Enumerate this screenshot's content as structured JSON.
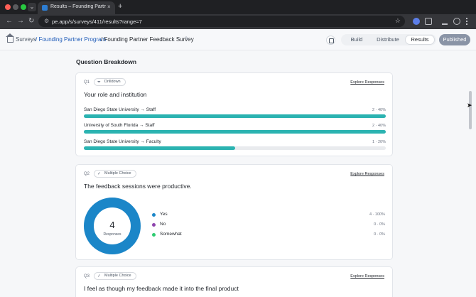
{
  "browser": {
    "tab_title": "Results – Founding Partner F",
    "tab_close": "×",
    "new_tab": "+",
    "url": "pe.app/s/surveys/411/results?range=7",
    "nav": {
      "back": "←",
      "forward": "→",
      "reload": "↻"
    },
    "star": "☆"
  },
  "header": {
    "breadcrumb": [
      {
        "label": "Surveys"
      },
      {
        "label": "/ Founding Partner Program"
      },
      {
        "label": "/ Founding Partner Feedback Survey"
      }
    ],
    "edit_icon": "✎",
    "tabs": [
      "Build",
      "Distribute",
      "Results"
    ],
    "active_tab": "Results",
    "status": "Published"
  },
  "main": {
    "section_title": "Question Breakdown",
    "questions": [
      {
        "number": "Q1",
        "type": "Drilldown",
        "type_icon": "funnel-icon",
        "explore": "Explore Responses",
        "title": "Your role and institution",
        "rows": [
          {
            "label": "San Diego State University → Staff",
            "value": "2 · 40%",
            "fraction": 1.0
          },
          {
            "label": "University of South Florida → Staff",
            "value": "2 · 40%",
            "fraction": 1.0
          },
          {
            "label": "San Diego State University → Faculty",
            "value": "1 · 20%",
            "fraction": 0.5
          }
        ]
      },
      {
        "number": "Q2",
        "type": "Multiple Choice",
        "type_icon": "check-circle-icon",
        "explore": "Explore Responses",
        "title": "The feedback sessions were productive.",
        "total": "4",
        "total_label": "Responses",
        "options": [
          {
            "label": "Yes",
            "value": "4 · 100%",
            "color": "#1b86c8",
            "fraction": 1.0
          },
          {
            "label": "No",
            "value": "0 · 0%",
            "color": "#8e44ad",
            "fraction": 0.0
          },
          {
            "label": "Somewhat",
            "value": "0 · 0%",
            "color": "#2ecc71",
            "fraction": 0.0
          }
        ]
      },
      {
        "number": "Q3",
        "type": "Multiple Choice",
        "type_icon": "check-circle-icon",
        "explore": "Explore Responses",
        "title": "I feel as though my feedback made it into the final product"
      }
    ]
  },
  "colors": {
    "bar": "#2bb3b1",
    "donut": "#1b86c8",
    "link": "#1e5bb8"
  }
}
